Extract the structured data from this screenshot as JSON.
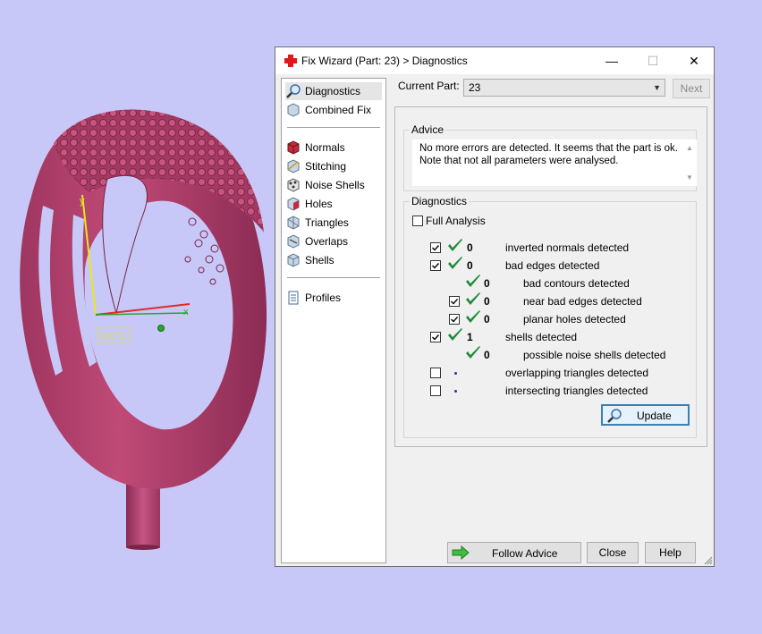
{
  "window": {
    "title": "Fix Wizard (Part: 23) > Diagnostics",
    "minimize": "—",
    "maximize": "☐",
    "close": "✕"
  },
  "viewport": {
    "wcs_label": "WCS",
    "axis_y": "y",
    "axis_x": "x"
  },
  "nav": {
    "items": [
      {
        "label": "Diagnostics",
        "icon": "magnifier-icon"
      },
      {
        "label": "Combined Fix",
        "icon": "combined-fix-icon"
      },
      {
        "label": "Normals",
        "icon": "normals-icon"
      },
      {
        "label": "Stitching",
        "icon": "stitching-icon"
      },
      {
        "label": "Noise Shells",
        "icon": "noise-shells-icon"
      },
      {
        "label": "Holes",
        "icon": "holes-icon"
      },
      {
        "label": "Triangles",
        "icon": "triangles-icon"
      },
      {
        "label": "Overlaps",
        "icon": "overlaps-icon"
      },
      {
        "label": "Shells",
        "icon": "shells-icon"
      },
      {
        "label": "Profiles",
        "icon": "profiles-icon"
      }
    ]
  },
  "current_part": {
    "label": "Current Part:",
    "value": "23"
  },
  "next_label": "Next",
  "advice": {
    "title": "Advice",
    "line1": "No more errors are detected. It seems that the part is ok.",
    "line2": "Note that not all parameters were analysed."
  },
  "diagnostics": {
    "title": "Diagnostics",
    "full_analysis": "Full Analysis",
    "rows": [
      {
        "checked": true,
        "status": "ok",
        "count": "0",
        "text": "inverted normals detected",
        "indent": 0
      },
      {
        "checked": true,
        "status": "ok",
        "count": "0",
        "text": "bad edges detected",
        "indent": 0
      },
      {
        "checked": null,
        "status": "ok",
        "count": "0",
        "text": "bad contours detected",
        "indent": 1
      },
      {
        "checked": true,
        "status": "ok",
        "count": "0",
        "text": "near bad edges detected",
        "indent": 1
      },
      {
        "checked": true,
        "status": "ok",
        "count": "0",
        "text": "planar holes detected",
        "indent": 1
      },
      {
        "checked": true,
        "status": "ok",
        "count": "1",
        "text": "shells detected",
        "indent": 0
      },
      {
        "checked": null,
        "status": "ok",
        "count": "0",
        "text": "possible noise shells detected",
        "indent": 1
      },
      {
        "checked": false,
        "status": "none",
        "count": "",
        "text": "overlapping triangles detected",
        "indent": 0
      },
      {
        "checked": false,
        "status": "none",
        "count": "",
        "text": "intersecting triangles detected",
        "indent": 0
      }
    ],
    "update_label": "Update"
  },
  "footer": {
    "follow_advice": "Follow Advice",
    "close": "Close",
    "help": "Help"
  },
  "colors": {
    "ring": "#b0406a",
    "check_green": "#1f8a3a",
    "background": "#c8c8f8"
  }
}
